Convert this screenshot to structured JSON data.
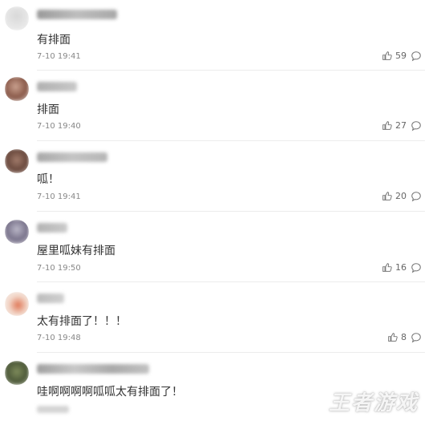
{
  "comments": [
    {
      "text": "有排面",
      "time": "7-10 19:41",
      "likes": "59"
    },
    {
      "text": "排面",
      "time": "7-10 19:40",
      "likes": "27"
    },
    {
      "text": "呱！",
      "time": "7-10 19:41",
      "likes": "20"
    },
    {
      "text": "屋里呱妹有排面",
      "time": "7-10 19:50",
      "likes": "16"
    },
    {
      "text": "太有排面了！！！",
      "time": "7-10 19:48",
      "likes": "8"
    },
    {
      "text": "哇啊啊啊啊呱呱太有排面了！"
    }
  ],
  "watermark": "王者游戏",
  "icons": {
    "like": "thumbs-up-icon",
    "reply": "comment-bubble-icon"
  }
}
